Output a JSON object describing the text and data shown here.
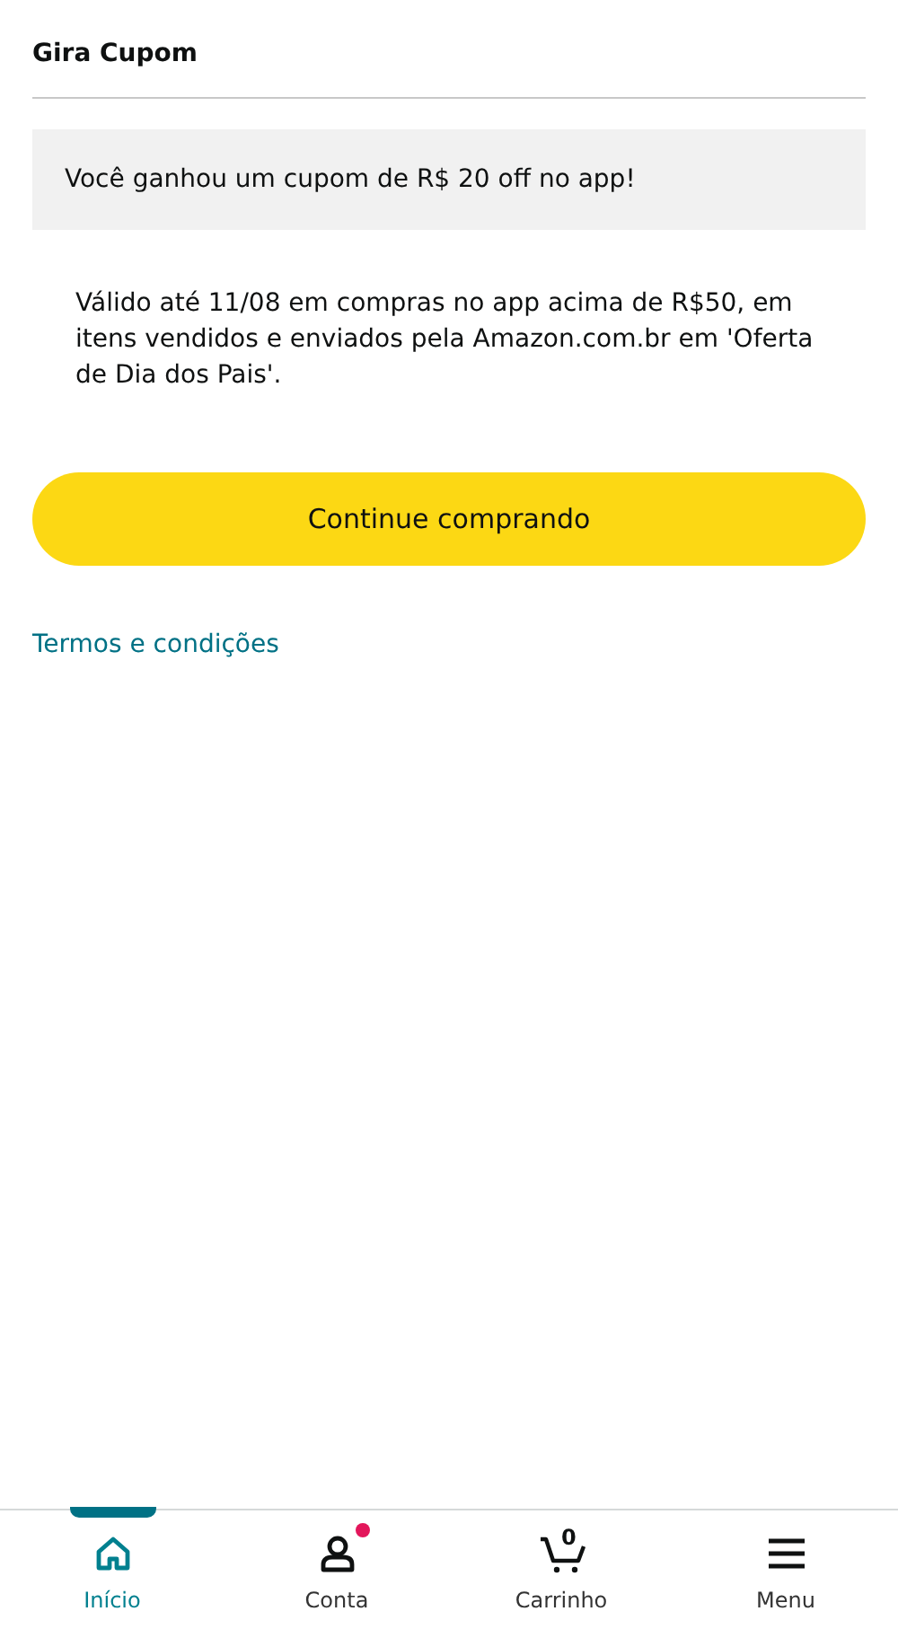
{
  "header": {
    "title": "Gira Cupom"
  },
  "banner": {
    "text": "Você ganhou um cupom de R$ 20 off no app!"
  },
  "description": "Válido até 11/08 em compras no app acima de R$50, em itens vendidos e enviados pela Amazon.com.br em 'Oferta de Dia dos Pais'.",
  "primary_button": "Continue comprando",
  "terms_link": "Termos e condições",
  "bottom_nav": [
    {
      "kind": "home",
      "label": "Início",
      "selected": true,
      "badge": false
    },
    {
      "kind": "account",
      "label": "Conta",
      "selected": false,
      "badge": true
    },
    {
      "kind": "cart",
      "label": "Carrinho",
      "selected": false,
      "badge": false,
      "count": "0"
    },
    {
      "kind": "menu",
      "label": "Menu",
      "selected": false,
      "badge": false
    }
  ]
}
